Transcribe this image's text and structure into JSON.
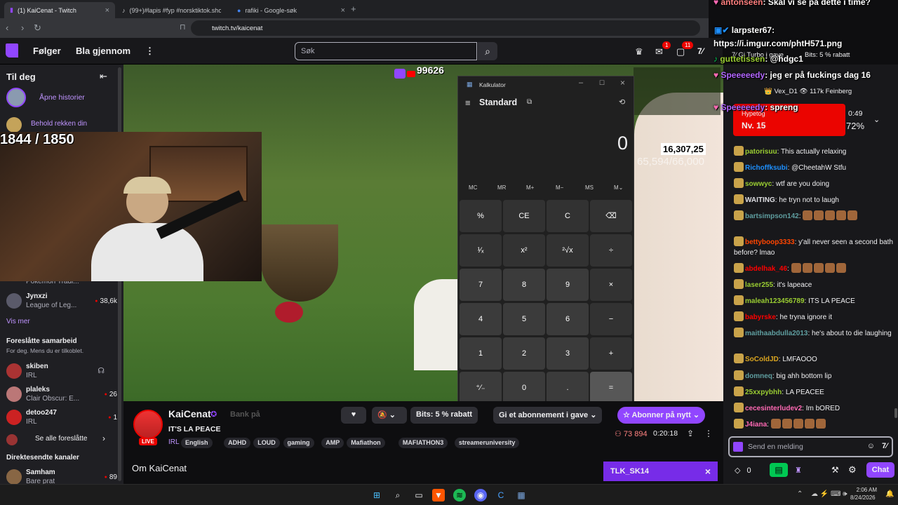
{
  "browser": {
    "tabs": [
      {
        "title": "(1) KaiCenat - Twitch"
      },
      {
        "title": "(99+)#lapis #fyp #norsktiktok.shout..."
      },
      {
        "title": "rafiki - Google-søk"
      }
    ],
    "url": "twitch.tv/kaicenat"
  },
  "nav": {
    "following": "Følger",
    "browse": "Bla gjennom",
    "search_placeholder": "Søk",
    "notif_1": "1",
    "notif_2": "11"
  },
  "sidebar": {
    "for_you": "Til deg",
    "open_stories": "Åpne historier",
    "keep_streak": "Behold rekken din",
    "pokemon_row": "Pokemon Tradi...",
    "pokemon_count": "",
    "channels": [
      {
        "name": "Jynxzi",
        "game": "League of Leg...",
        "count": "38,6k"
      }
    ],
    "see_more": "Vis mer",
    "collab_title": "Foreslåtte samarbeid",
    "collab_sub": "For deg. Mens du er tilkoblet.",
    "collab": [
      {
        "name": "skiben",
        "game": "IRL",
        "count": ""
      },
      {
        "name": "plaleks",
        "game": "Clair Obscur: E...",
        "count": "26"
      },
      {
        "name": "detoo247",
        "game": "IRL",
        "count": "1"
      }
    ],
    "see_all_suggested": "Se alle foreslåtte",
    "live_title": "Direktesendte kanaler",
    "live": [
      {
        "name": "Samham",
        "game": "Bare prat",
        "count": "89"
      }
    ]
  },
  "overlay": {
    "counter": "1844 / 1850",
    "subs": "99626",
    "money": "16,307,25",
    "goal": "65,594/66,000"
  },
  "calculator": {
    "window_title": "Kalkulator",
    "mode": "Standard",
    "display": "0",
    "memory": [
      "MC",
      "MR",
      "M+",
      "M−",
      "MS",
      "M⌄"
    ],
    "keys": [
      [
        "%",
        "CE",
        "C",
        "⌫"
      ],
      [
        "¹⁄ₓ",
        "x²",
        "²√x",
        "÷"
      ],
      [
        "7",
        "8",
        "9",
        "×"
      ],
      [
        "4",
        "5",
        "6",
        "−"
      ],
      [
        "1",
        "2",
        "3",
        "+"
      ],
      [
        "⁺∕₋",
        "0",
        ".",
        "="
      ]
    ]
  },
  "stream": {
    "channel": "KaiCenat",
    "title": "IT'S LA PEACE",
    "live": "LIVE",
    "category": "IRL",
    "tags": [
      "English",
      "ADHD",
      "LOUD",
      "gaming",
      "AMP",
      "Mafiathon",
      "MAFIATHON3",
      "streameruniversity"
    ],
    "bank": "Bank på",
    "bits": "Bits: 5 % rabatt",
    "gift_sub": "Gi et abonnement i gave",
    "resub": "Abonner på nytt",
    "viewers": "73 894",
    "uptime": "0:20:18",
    "about": "Om KaiCenat",
    "promo": "TLK_SK14"
  },
  "chat_overlay": [
    {
      "user": "antonseen",
      "text": "Skal vi se på dette i time?"
    },
    {
      "user": "larpster67",
      "text": "https://i.imgur.com/phtH571.png"
    },
    {
      "user": "guttetissen",
      "text": "@hdgc1"
    },
    {
      "user": "Speeeeedy",
      "text": "jeg er på fuckings dag 16"
    },
    {
      "user": "Speeeeedy",
      "text": "spreng"
    }
  ],
  "chat_header": {
    "gift_turbo": "Gi Turbo i gave",
    "bits": "Bits: 5 % rabatt",
    "streamer": "Vex_D1",
    "viewers": "117k",
    "other": "Feinberg",
    "prediction_title": "Hypetog",
    "prediction_level": "Nv. 15",
    "prediction_time": "0:49",
    "prediction_pct": "72%"
  },
  "chat": [
    {
      "user": "patorisuu",
      "text": "This actually relaxing",
      "color": "#9acd32"
    },
    {
      "user": "Richoffksubi",
      "text": "@CheetahW Stfu",
      "color": "#1e90ff"
    },
    {
      "user": "sowwyc",
      "text": "wtf are you doing",
      "color": "#9acd32"
    },
    {
      "user": "WAITING",
      "text": "he tryn not to laugh",
      "color": "#dedee3"
    },
    {
      "user": "bartsimpson142",
      "text": "",
      "color": "#5f9ea0"
    },
    {
      "user": "bettyboop3333",
      "text": "y'all never seen a second bath before? lmao",
      "color": "#ff4500"
    },
    {
      "user": "abdelhak_46",
      "text": "",
      "color": "#ff0000"
    },
    {
      "user": "laser255",
      "text": "it's lapeace",
      "color": "#9acd32"
    },
    {
      "user": "maleah123456789",
      "text": "ITS LA PEACE",
      "color": "#9acd32"
    },
    {
      "user": "babyrske",
      "text": "he tryna ignore it",
      "color": "#ff0000"
    },
    {
      "user": "maithaabdulla2013",
      "text": "he's about to die laughing",
      "color": "#5f9ea0"
    },
    {
      "user": "SoColdJD",
      "text": "LMFAOOO",
      "color": "#daa520"
    },
    {
      "user": "domneq",
      "text": "big ahh bottom lip",
      "color": "#5f9ea0"
    },
    {
      "user": "25xxpybhh",
      "text": "LA PEACEE",
      "color": "#9acd32"
    },
    {
      "user": "cecesinterludev2",
      "text": "Im bORED",
      "color": "#ff69b4"
    },
    {
      "user": "J4iana",
      "text": "",
      "color": "#ff69b4"
    }
  ],
  "chat_input": {
    "placeholder": "Send en melding",
    "points": "0",
    "chat_btn": "Chat"
  },
  "taskbar": {
    "time": "2:06 AM",
    "date": "8/24/2026"
  }
}
